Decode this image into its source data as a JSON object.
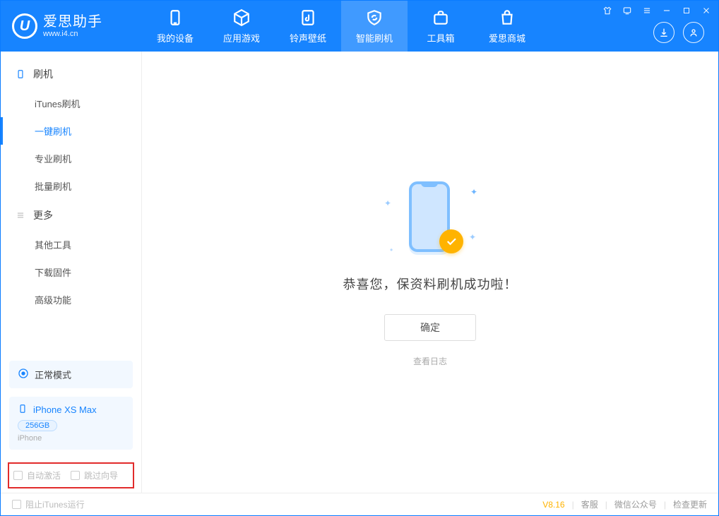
{
  "brand": {
    "title": "爱思助手",
    "subtitle": "www.i4.cn"
  },
  "navtabs": [
    {
      "id": "my-device",
      "label": "我的设备"
    },
    {
      "id": "apps-games",
      "label": "应用游戏"
    },
    {
      "id": "ring-wall",
      "label": "铃声壁纸"
    },
    {
      "id": "smart-flash",
      "label": "智能刷机"
    },
    {
      "id": "toolbox",
      "label": "工具箱"
    },
    {
      "id": "store",
      "label": "爱思商城"
    }
  ],
  "sidebar": {
    "section1": {
      "title": "刷机",
      "items": [
        "iTunes刷机",
        "一键刷机",
        "专业刷机",
        "批量刷机"
      ]
    },
    "section2": {
      "title": "更多",
      "items": [
        "其他工具",
        "下载固件",
        "高级功能"
      ]
    }
  },
  "mode": {
    "label": "正常模式"
  },
  "device": {
    "name": "iPhone XS Max",
    "capacity": "256GB",
    "type": "iPhone"
  },
  "checks": {
    "auto_activate": "自动激活",
    "skip_guide": "跳过向导"
  },
  "main": {
    "success_msg": "恭喜您，保资料刷机成功啦！",
    "ok_button": "确定",
    "view_log": "查看日志"
  },
  "footer": {
    "block_itunes": "阻止iTunes运行",
    "version": "V8.16",
    "links": [
      "客服",
      "微信公众号",
      "检查更新"
    ]
  }
}
